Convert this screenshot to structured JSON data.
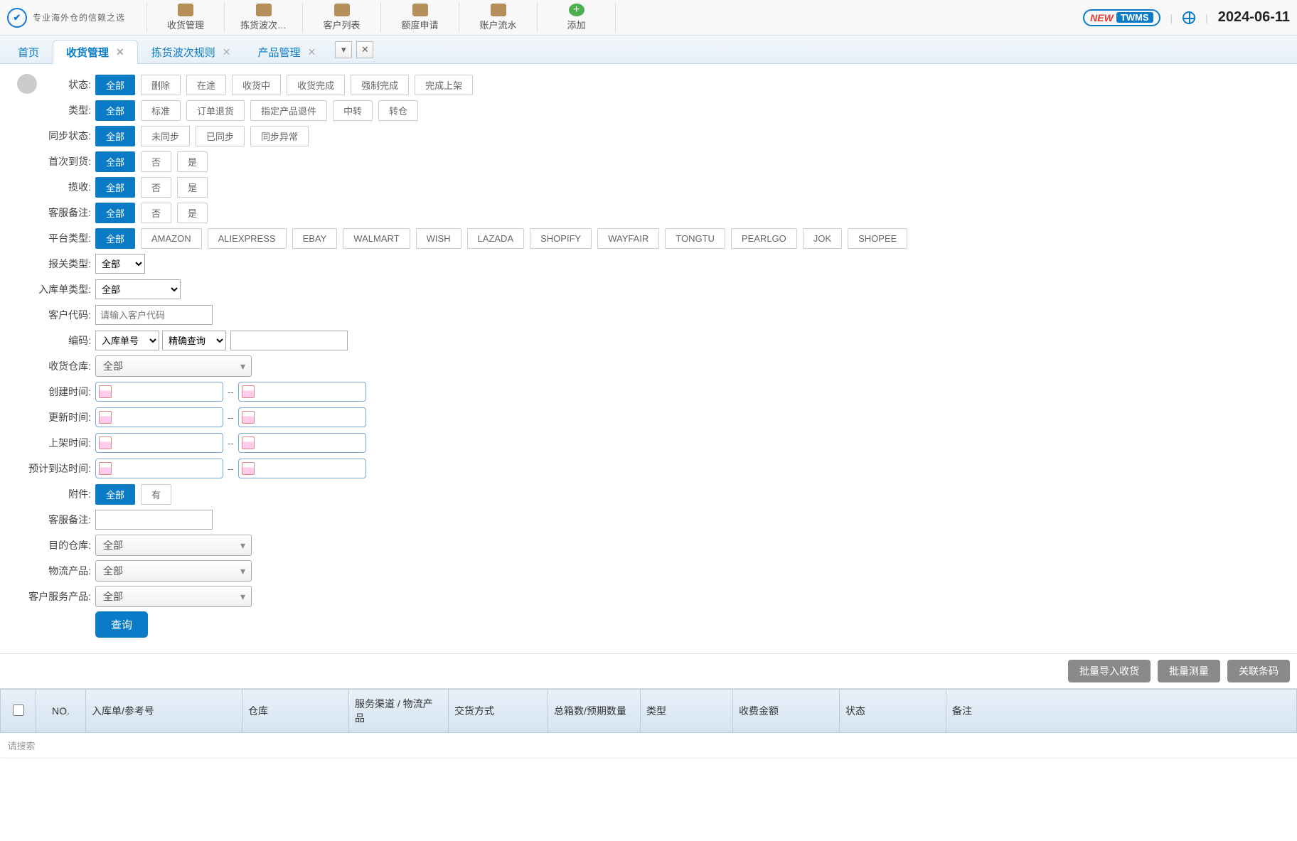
{
  "header": {
    "tagline": "专业海外仓的信赖之选",
    "nav": [
      {
        "label": "收货管理"
      },
      {
        "label": "拣货波次…"
      },
      {
        "label": "客户列表"
      },
      {
        "label": "额度申请"
      },
      {
        "label": "账户流水"
      },
      {
        "label": "添加"
      }
    ],
    "new_badge_new": "NEW",
    "new_badge_twms": "TWMS",
    "date": "2024-06-11"
  },
  "tabs": [
    {
      "label": "首页",
      "closable": false,
      "active": false
    },
    {
      "label": "收货管理",
      "closable": true,
      "active": true
    },
    {
      "label": "拣货波次规则",
      "closable": true,
      "active": false
    },
    {
      "label": "产品管理",
      "closable": true,
      "active": false
    }
  ],
  "filters": {
    "status": {
      "label": "状态:",
      "opts": [
        "全部",
        "删除",
        "在途",
        "收货中",
        "收货完成",
        "强制完成",
        "完成上架"
      ],
      "active": 0
    },
    "type": {
      "label": "类型:",
      "opts": [
        "全部",
        "标准",
        "订单退货",
        "指定产品退件",
        "中转",
        "转仓"
      ],
      "active": 0
    },
    "sync": {
      "label": "同步状态:",
      "opts": [
        "全部",
        "未同步",
        "已同步",
        "同步异常"
      ],
      "active": 0
    },
    "first_arrival": {
      "label": "首次到货:",
      "opts": [
        "全部",
        "否",
        "是"
      ],
      "active": 0
    },
    "collect": {
      "label": "揽收:",
      "opts": [
        "全部",
        "否",
        "是"
      ],
      "active": 0
    },
    "cs_remark_flag": {
      "label": "客服备注:",
      "opts": [
        "全部",
        "否",
        "是"
      ],
      "active": 0
    },
    "platform": {
      "label": "平台类型:",
      "opts": [
        "全部",
        "AMAZON",
        "ALIEXPRESS",
        "EBAY",
        "WALMART",
        "WISH",
        "LAZADA",
        "SHOPIFY",
        "WAYFAIR",
        "TONGTU",
        "PEARLGO",
        "JOK",
        "SHOPEE"
      ],
      "active": 0
    },
    "customs_type": {
      "label": "报关类型:",
      "value": "全部"
    },
    "inbound_type": {
      "label": "入库单类型:",
      "value": "全部"
    },
    "client_code": {
      "label": "客户代码:",
      "placeholder": "请输入客户代码"
    },
    "code": {
      "label": "编码:",
      "sel1": "入库单号",
      "sel2": "精确查询"
    },
    "recv_wh": {
      "label": "收货仓库:",
      "value": "全部"
    },
    "create_time": {
      "label": "创建时间:"
    },
    "update_time": {
      "label": "更新时间:"
    },
    "shelf_time": {
      "label": "上架时间:"
    },
    "eta_time": {
      "label": "预计到达时间:"
    },
    "attachment": {
      "label": "附件:",
      "opts": [
        "全部",
        "有"
      ],
      "active": 0
    },
    "cs_remark": {
      "label": "客服备注:"
    },
    "dest_wh": {
      "label": "目的仓库:",
      "value": "全部"
    },
    "logistics_product": {
      "label": "物流产品:",
      "value": "全部"
    },
    "client_service_product": {
      "label": "客户服务产品:",
      "value": "全部"
    },
    "search_btn": "查询"
  },
  "actions": {
    "import": "批量导入收货",
    "measure": "批量测量",
    "barcode": "关联条码"
  },
  "table": {
    "cols": [
      "NO.",
      "入库单/参考号",
      "仓库",
      "服务渠道 / 物流产品",
      "交货方式",
      "总箱数/预期数量",
      "类型",
      "收费金额",
      "状态",
      "备注"
    ],
    "search_placeholder": "请搜索"
  }
}
